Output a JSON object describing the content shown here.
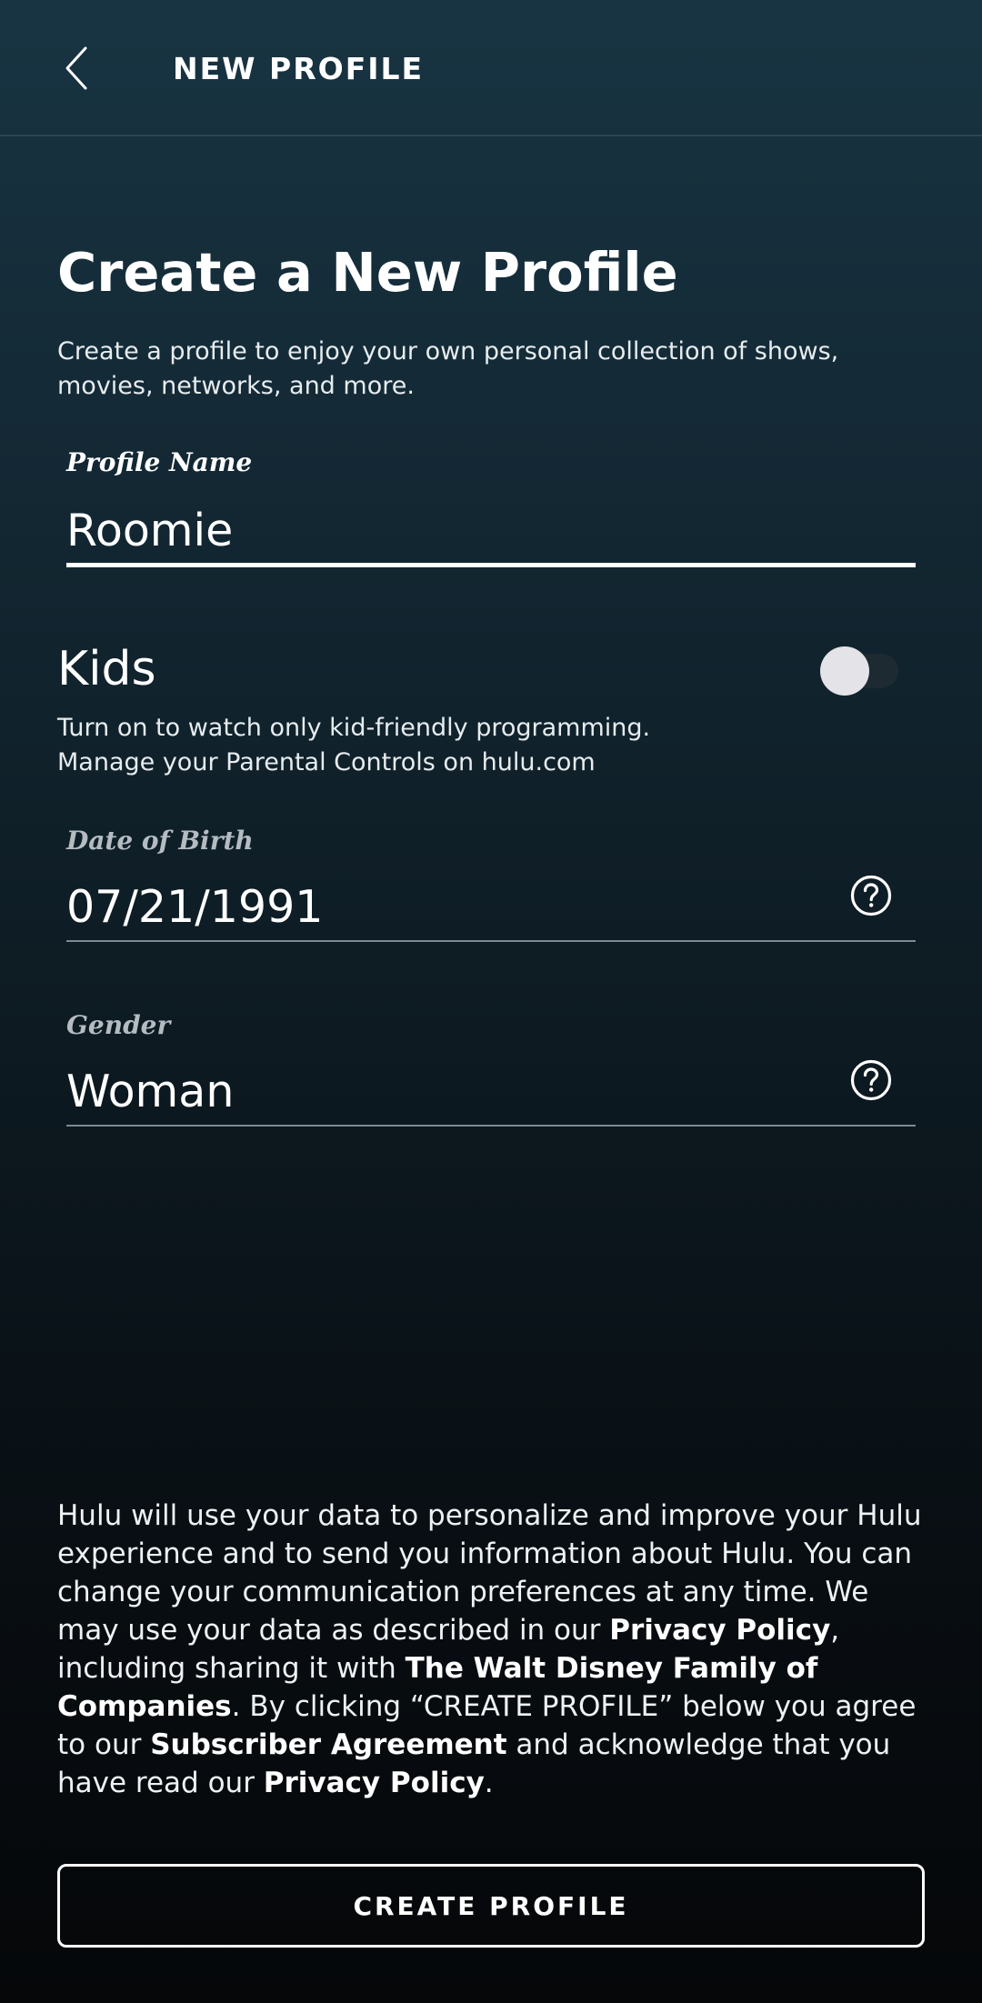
{
  "header": {
    "title": "NEW PROFILE",
    "back_icon": "chevron-left-icon"
  },
  "main": {
    "title": "Create a New Profile",
    "subtitle": "Create a profile to enjoy your own personal collection of shows, movies, networks, and more."
  },
  "profile_name": {
    "label": "Profile Name",
    "value": "Roomie"
  },
  "kids": {
    "title": "Kids",
    "toggle_on": false,
    "desc_line1": "Turn on to watch only kid-friendly programming.",
    "desc_line2": "Manage your Parental Controls on hulu.com"
  },
  "dob": {
    "label": "Date of Birth",
    "value": "07/21/1991",
    "help_icon": "question-circle-icon"
  },
  "gender": {
    "label": "Gender",
    "value": "Woman",
    "help_icon": "question-circle-icon"
  },
  "legal": {
    "t1": "Hulu will use your data to personalize and improve your Hulu experience and to send you information about Hulu. You can change your communication preferences at any time. We may use your data as described in our ",
    "l1": "Privacy Policy",
    "t2": ", including sharing it with ",
    "l2": "The Walt Disney Family of Companies",
    "t3": ". By clicking “CREATE PROFILE” below you agree to our ",
    "l3": "Subscriber Agreement",
    "t4": " and acknowledge that you have read our ",
    "l4": "Privacy Policy",
    "t5": "."
  },
  "create_button_label": "CREATE PROFILE",
  "colors": {
    "background_top": "#183442",
    "background_bottom": "#050709",
    "label_active": "#ffffff",
    "label_inactive": "#b4bcc2",
    "underline_active": "#ffffff",
    "underline_inactive": "#7d8a92",
    "toggle_knob": "#e3e3e8",
    "toggle_track": "#1d2a31"
  }
}
